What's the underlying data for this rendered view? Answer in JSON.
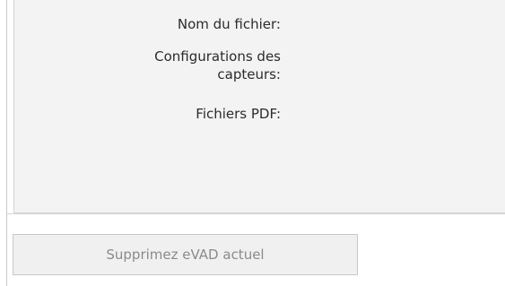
{
  "details": {
    "filename_label": "Nom du fichier:",
    "sensor_config_label_line1": "Configurations des",
    "sensor_config_label_line2": "capteurs:",
    "pdf_files_label": "Fichiers PDF:"
  },
  "actions": {
    "delete_button_label": "Supprimez eVAD actuel",
    "delete_button_state": "disabled"
  },
  "colors": {
    "panel_background": "#f3f3f3",
    "button_background": "#f0f0f0",
    "disabled_text": "#8a8a8a",
    "border": "#c8c8c8"
  }
}
